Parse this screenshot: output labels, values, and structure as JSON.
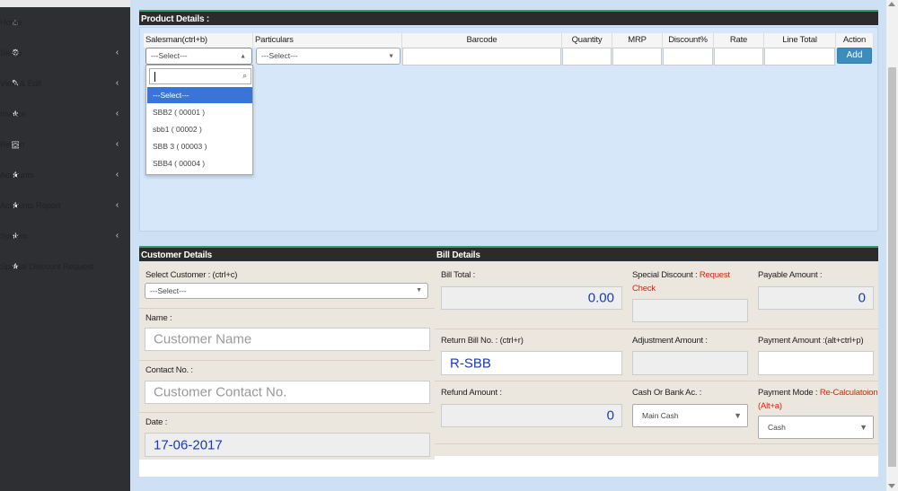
{
  "sidebar": {
    "items": [
      {
        "label": "Home",
        "icon": "home-icon",
        "glyph": "⌂",
        "chevron": false
      },
      {
        "label": "Setup",
        "icon": "gears-icon",
        "glyph": "⚙",
        "chevron": true
      },
      {
        "label": "View & Edit",
        "icon": "edit-icon",
        "glyph": "✎",
        "chevron": true
      },
      {
        "label": "Invoice",
        "icon": "star-icon",
        "glyph": "★",
        "chevron": true
      },
      {
        "label": "Report",
        "icon": "file-icon",
        "glyph": "▤",
        "chevron": true
      },
      {
        "label": "Accounts",
        "icon": "star-icon",
        "glyph": "★",
        "chevron": true
      },
      {
        "label": "Accounts Report",
        "icon": "star-icon",
        "glyph": "★",
        "chevron": true
      },
      {
        "label": "System",
        "icon": "star-icon",
        "glyph": "★",
        "chevron": true
      },
      {
        "label": "Special Discount Request",
        "icon": "star-icon",
        "glyph": "★",
        "chevron": false
      }
    ],
    "chevron_glyph": "‹"
  },
  "product": {
    "title": "Product Details :",
    "headers": {
      "salesman": "Salesman(ctrl+b)",
      "particulars": "Particulars",
      "barcode": "Barcode",
      "quantity": "Quantity",
      "mrp": "MRP",
      "discount": "Discount%",
      "rate": "Rate",
      "line_total": "Line Total",
      "action": "Action"
    },
    "salesman_value": "---Select---",
    "particulars_value": "---Select---",
    "add_label": "Add",
    "dropdown": {
      "search_value": "",
      "options": [
        "---Select---",
        "SBB2 ( 00001 )",
        "sbb1 ( 00002 )",
        "SBB 3 ( 00003 )",
        "SBB4 ( 00004 )"
      ],
      "selected_index": 0
    }
  },
  "customer": {
    "title": "Customer Details",
    "select_label": "Select Customer : (ctrl+c)",
    "select_value": "---Select---",
    "name_label": "Name :",
    "name_placeholder": "Customer Name",
    "contact_label": "Contact No. :",
    "contact_placeholder": "Customer Contact No.",
    "date_label": "Date :",
    "date_value": "17-06-2017"
  },
  "bill": {
    "title": "Bill Details",
    "bill_total_label": "Bill Total :",
    "bill_total_value": "0.00",
    "special_discount_label": "Special Discount :",
    "special_discount_link_1": "Request",
    "special_discount_link_2": "Check",
    "payable_label": "Payable Amount :",
    "payable_value": "0",
    "return_bill_label": "Return Bill No. : (ctrl+r)",
    "return_bill_value": "R-SBB",
    "adjustment_label": "Adjustment Amount :",
    "payment_amount_label": "Payment Amount :(alt+ctrl+p)",
    "refund_label": "Refund Amount :",
    "refund_value": "0",
    "cash_bank_label": "Cash Or Bank Ac. :",
    "cash_bank_value": "Main Cash",
    "payment_mode_label": "Payment Mode :",
    "payment_mode_link_1": "Re-Calculatoion",
    "payment_mode_link_2": "(Alt+a)",
    "payment_mode_value": "Cash"
  },
  "colors": {
    "sidebar": "#2d2f33",
    "panel_header": "#2b2b2b",
    "accent_green": "#3c9a6a",
    "add_button": "#3c8dbc",
    "link_red": "#d9230f",
    "value_blue": "#1a3ab4",
    "page_bg": "#cde0f4"
  }
}
